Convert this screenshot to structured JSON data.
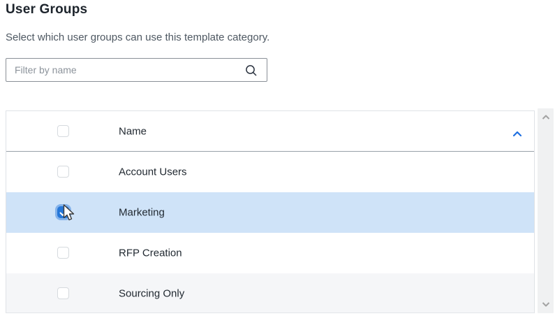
{
  "page": {
    "title": "User Groups",
    "subtitle": "Select which user groups can use this template category."
  },
  "filter": {
    "placeholder": "Filter by name",
    "value": "",
    "icon": "search-icon"
  },
  "table": {
    "columns": [
      {
        "label": "Name",
        "sort": "ascending"
      }
    ],
    "select_all_checked": false,
    "rows": [
      {
        "name": "Account Users",
        "checked": false,
        "selected": false
      },
      {
        "name": "Marketing",
        "checked": true,
        "selected": true
      },
      {
        "name": "RFP Creation",
        "checked": false,
        "selected": false
      },
      {
        "name": "Sourcing Only",
        "checked": false,
        "selected": false
      }
    ]
  },
  "scrollbar": {
    "orientation": "vertical",
    "up_icon": "chevron-up-icon",
    "down_icon": "chevron-down-icon"
  },
  "cursor": {
    "visible": true,
    "type": "arrow",
    "over": "marketing-row-checkbox"
  },
  "colors": {
    "accent_blue": "#2577d8",
    "selected_row_bg": "#cfe3f8",
    "alt_row_bg": "#f5f6f8",
    "sort_icon_blue": "#1e6fe0",
    "header_border": "#98a0a8",
    "table_border": "#dfe2e6",
    "scrollbar_track": "#f0f1f2"
  }
}
